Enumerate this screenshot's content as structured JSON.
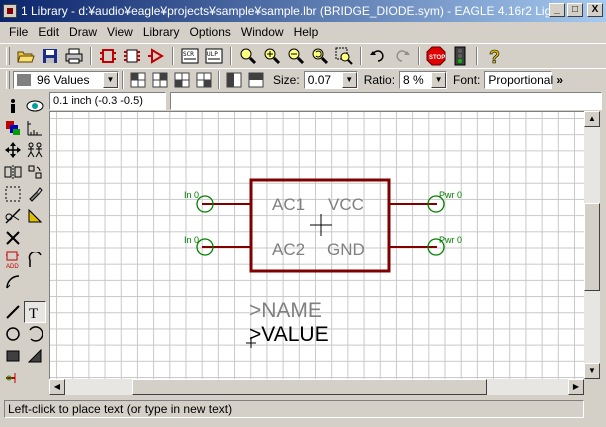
{
  "window": {
    "title": "1 Library - d:¥audio¥eagle¥projects¥sample¥sample.lbr (BRIDGE_DIODE.sym) - EAGLE 4.16r2 Light",
    "minimize": "_",
    "maximize": "□",
    "close": "X"
  },
  "menu": {
    "items": [
      "File",
      "Edit",
      "Draw",
      "View",
      "Library",
      "Options",
      "Window",
      "Help"
    ]
  },
  "toolbar1": {
    "icons": [
      "open-icon",
      "save-icon",
      "print-icon",
      "device-icon",
      "package-icon",
      "symbol-icon",
      "script-icon",
      "ulp-icon",
      "zoom-fit-icon",
      "zoom-in-icon",
      "zoom-out-icon",
      "zoom-redraw-icon",
      "zoom-select-icon",
      "undo-icon",
      "redo-icon",
      "stop-icon",
      "go-icon",
      "help-icon"
    ]
  },
  "toolbar2": {
    "layer_value": "96 Values",
    "layer_color": "#808080",
    "size_label": "Size:",
    "size_value": "0.07",
    "ratio_label": "Ratio:",
    "ratio_value": "8 %",
    "font_label": "Font:",
    "font_value": "Proportional",
    "more": "»"
  },
  "coord": {
    "readout": "0.1 inch (-0.3 -0.5)",
    "command": ""
  },
  "symbol": {
    "body_color": "#800000",
    "pin_color": "#008000",
    "text_color": "#808080",
    "labels": {
      "ac1": "AC1",
      "vcc": "VCC",
      "ac2": "AC2",
      "gnd": "GND"
    },
    "pin_names": {
      "in0_top": "In 0",
      "in0_bottom": "In 0",
      "pwr0_top": "Pwr 0",
      "pwr0_bottom": "Pwr 0"
    },
    "name_text": ">NAME",
    "value_text": ">VALUE"
  },
  "status": {
    "message": "Left-click to place text (or type in new text)"
  }
}
